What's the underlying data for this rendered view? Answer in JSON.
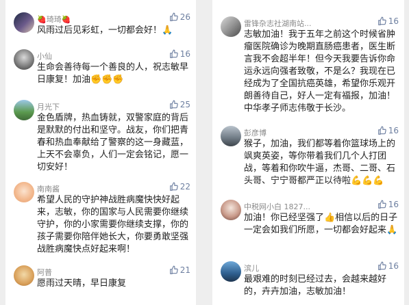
{
  "left": [
    {
      "name": "🍓琦琦🍓",
      "likes": "26",
      "text": "风雨过后见彩虹，一切都会好！🙏"
    },
    {
      "name": "小仙",
      "likes": "16",
      "text": "生命会善待每一个善良的人，祝志敏早日康复！加油✊✊✊"
    },
    {
      "name": "月光下",
      "likes": "25",
      "text": "金色盾牌，热血铸就，双警家庭的背后是默默的付出和坚守。战友，你们把青春和热血奉献给了警察的这一身藏蓝，上天不会辜负，人们一定会铭记，愿一切安好！"
    },
    {
      "name": "南南酱",
      "likes": "22",
      "text": "希望人民的守护神战胜病魔快快好起来，志敏，你的国家与人民需要你继续守护，你的小家需要你继续支撑，你的孩子需要你陪伴她长大，你要勇敢坚强战胜病魔快点好起来啊！"
    },
    {
      "name": "阿普",
      "likes": "21",
      "text": "愿雨过天晴，早日康复"
    }
  ],
  "right": [
    {
      "name": "雷锋杂志社湖南站...",
      "likes": "16",
      "text": "志敏加油！我于五年之前这个时候省肿瘤医院确诊为晚期直肠癌患者，医生断言我不会超半年！但今天我要告诉你命运永远向强者致敬，不是么？我现在已经成为了全国抗癌英雄，希望你乐观开朗善待自己，好人一定有福报，加油！中华孝子师志伟敬于长沙。"
    },
    {
      "name": "彭彦博",
      "likes": "16",
      "text": "猴子，加油，我们都等着你篮球场上的飒爽英姿，等你带着我们几个人打团战，等着和你吹牛逼，杰哥、二哥、石头哥、宁宁哥都严正以待啦💪💪💪"
    },
    {
      "name": "中税网小白 1827...",
      "likes": "16",
      "text": "加油！你已经坚强了👍相信以后的日子一定会如我们所愿，一切都会好起来🙏"
    },
    {
      "name": "滨儿",
      "likes": "16",
      "text": "最艰难的时刻已经过去，会越来越好的，卉卉加油，志敏加油！"
    }
  ],
  "colors": {
    "name": "#8a8a8a",
    "like": "#6d7fa0",
    "text": "#222222",
    "background": "#eeeeee"
  },
  "icons": {
    "like": "thumbs-up-icon"
  }
}
